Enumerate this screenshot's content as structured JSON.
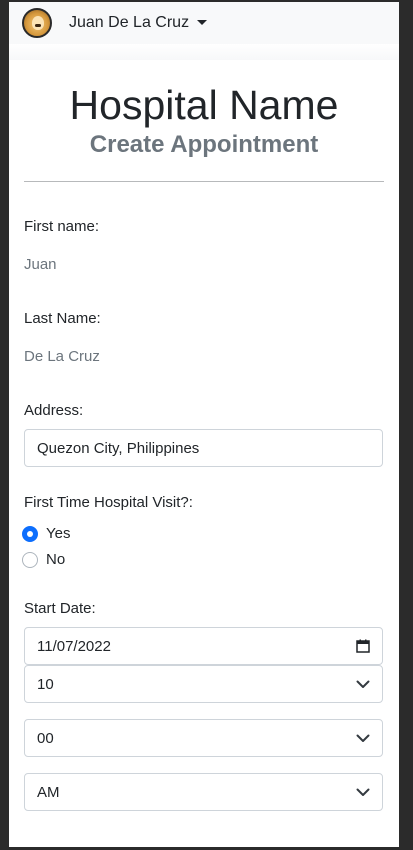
{
  "navbar": {
    "user_name": "Juan De La Cruz"
  },
  "header": {
    "title": "Hospital Name",
    "subtitle": "Create Appointment"
  },
  "form": {
    "first_name_label": "First name:",
    "first_name_value": "Juan",
    "last_name_label": "Last Name:",
    "last_name_value": "De La Cruz",
    "address_label": "Address:",
    "address_value": "Quezon City, Philippines",
    "first_visit_label": "First Time Hospital Visit?:",
    "first_visit_options": [
      {
        "label": "Yes",
        "checked": true
      },
      {
        "label": "No",
        "checked": false
      }
    ],
    "start_date_label": "Start Date:",
    "start_date_value": "11/07/2022",
    "hour_value": "10",
    "minute_value": "00",
    "period_value": "AM"
  },
  "colors": {
    "accent": "#0d6efd",
    "muted": "#6c757d",
    "navbar_bg": "#f8f9fa"
  },
  "icons": {
    "avatar": "doge-avatar",
    "caret": "caret-down-icon",
    "calendar": "calendar-icon",
    "chevron": "chevron-down-icon"
  }
}
